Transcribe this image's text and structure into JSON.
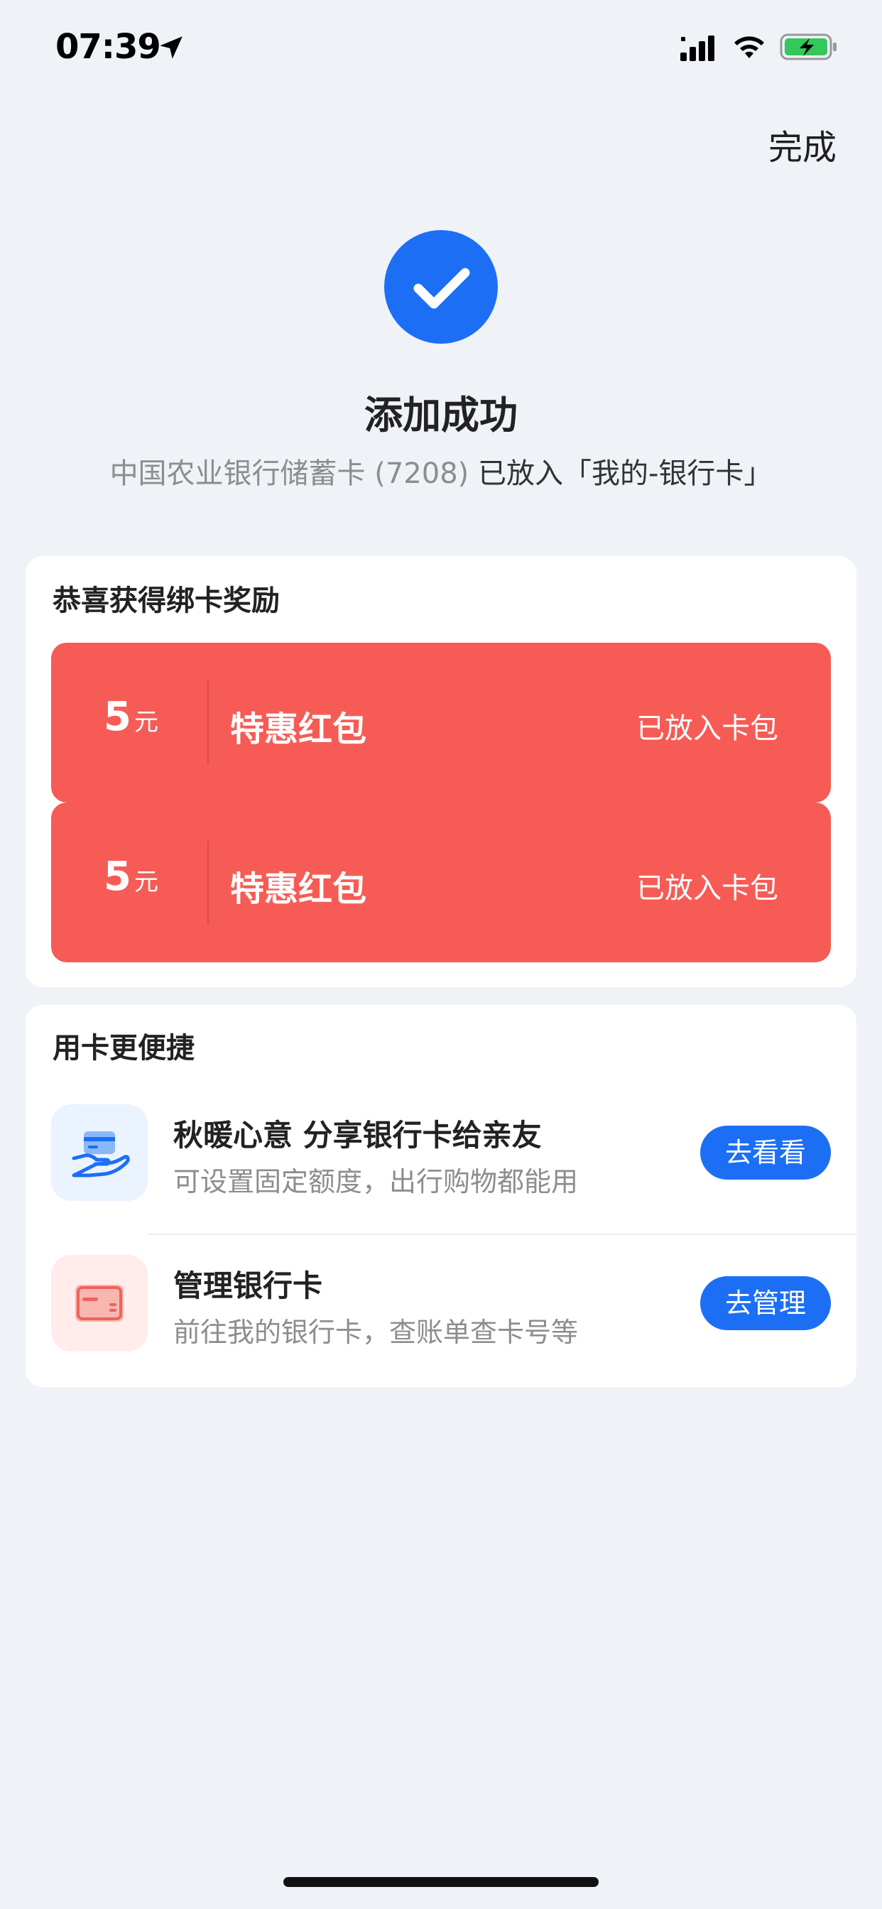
{
  "status_bar": {
    "time": "07:39",
    "icons": [
      "location-arrow-icon",
      "cellular-signal-icon",
      "wifi-icon",
      "battery-charging-icon"
    ],
    "battery_color": "#34c759"
  },
  "header": {
    "done_label": "完成"
  },
  "success": {
    "icon": "checkmark-icon",
    "title": "添加成功",
    "subtitle_muted": "中国农业银行储蓄卡 (7208) ",
    "subtitle_main": "已放入「我的-银行卡」"
  },
  "rewards": {
    "title": "恭喜获得绑卡奖励",
    "coupons": [
      {
        "amount": "5",
        "unit": "元",
        "name": "特惠红包",
        "status": "已放入卡包"
      },
      {
        "amount": "5",
        "unit": "元",
        "name": "特惠红包",
        "status": "已放入卡包"
      }
    ],
    "coupon_color": "#f65b55"
  },
  "convenient": {
    "title": "用卡更便捷",
    "items": [
      {
        "icon": "share-card-hand-icon",
        "title": "秋暖心意 分享银行卡给亲友",
        "desc": "可设置固定额度，出行购物都能用",
        "button": "去看看"
      },
      {
        "icon": "bank-card-icon",
        "title": "管理银行卡",
        "desc": "前往我的银行卡，查账单查卡号等",
        "button": "去管理"
      }
    ],
    "button_color": "#1c6ff5"
  }
}
